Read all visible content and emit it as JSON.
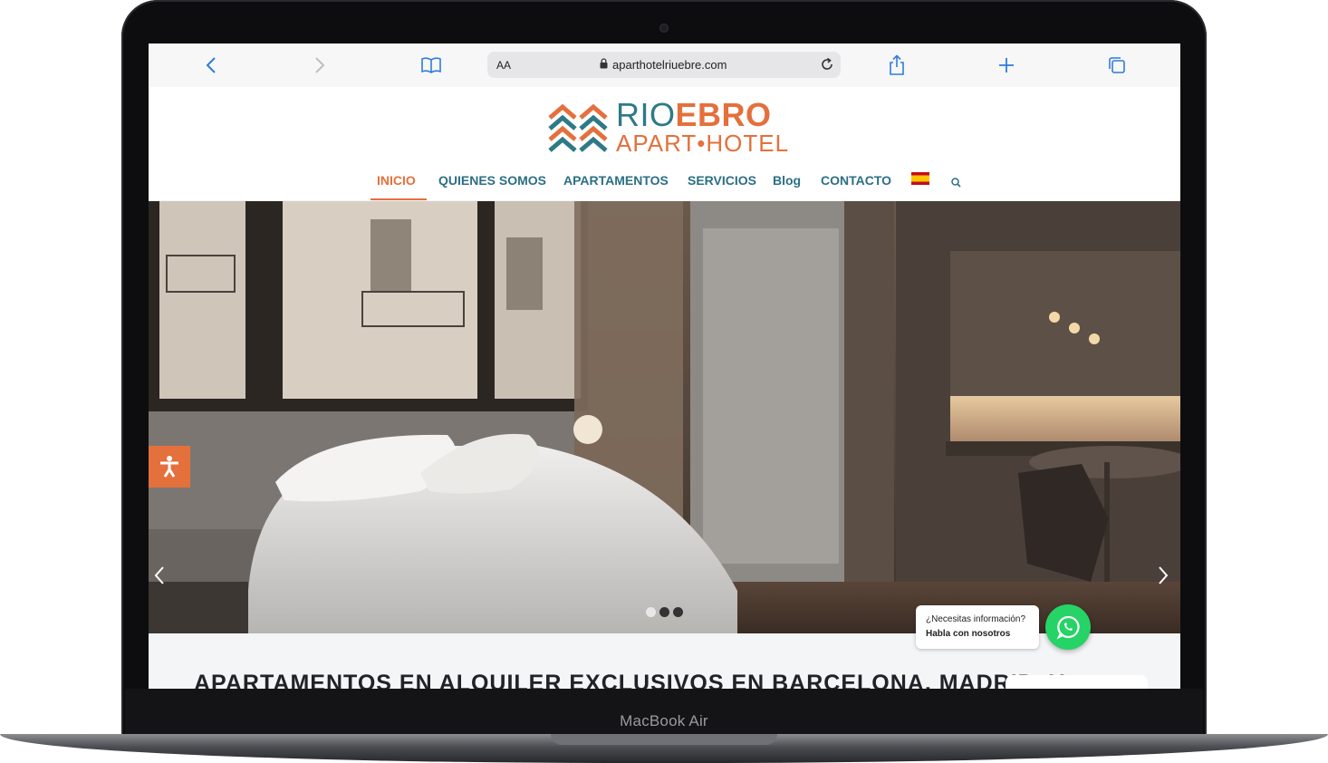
{
  "device": {
    "model_label": "MacBook Air"
  },
  "browser": {
    "reader_label": "AA",
    "url": "aparthotelriuebre.com",
    "icons": [
      "back-icon",
      "forward-icon",
      "bookmarks-icon",
      "lock-icon",
      "reload-icon",
      "share-icon",
      "new-tab-icon",
      "tabs-icon"
    ]
  },
  "site": {
    "logo": {
      "part1": "RIO",
      "part2": "EBRO",
      "subtitle": "APART•HOTEL"
    },
    "nav": {
      "items": [
        "INICIO",
        "QUIENES SOMOS",
        "APARTAMENTOS",
        "SERVICIOS",
        "Blog",
        "CONTACTO"
      ],
      "active": "INICIO",
      "language_flag": "spain-flag-icon"
    },
    "hero": {
      "slides": 3,
      "active_slide": 1
    },
    "section_title": "APARTAMENTOS EN ALQUILER EXCLUSIVOS EN BARCELONA, MADRID, Y",
    "whatsapp": {
      "line1": "¿Necesitas información?",
      "line2": "Habla con nosotros"
    }
  },
  "colors": {
    "brand_orange": "#e4703c",
    "brand_teal": "#2e7a86",
    "nav_text": "#2c6f86",
    "whatsapp_green": "#25d366"
  }
}
